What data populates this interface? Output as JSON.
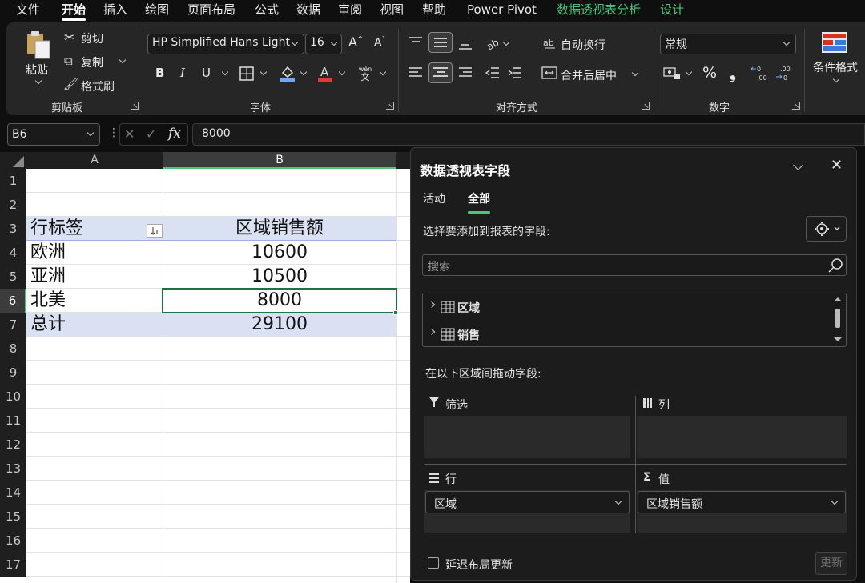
{
  "menu": {
    "tabs": [
      "文件",
      "开始",
      "插入",
      "绘图",
      "页面布局",
      "公式",
      "数据",
      "审阅",
      "视图",
      "帮助",
      "Power Pivot",
      "数据透视表分析",
      "设计"
    ]
  },
  "ribbon": {
    "clipboard": {
      "paste": "粘贴",
      "cut": "剪切",
      "copy": "复制",
      "format_painter": "格式刷",
      "label": "剪贴板"
    },
    "font": {
      "name": "HP Simplified Hans Light",
      "size": "16",
      "bold": "B",
      "italic": "I",
      "underline": "U",
      "label": "字体",
      "wen_top": "wén",
      "wen_bottom": "文"
    },
    "alignment": {
      "wrap": "自动换行",
      "merge": "合并后居中",
      "label": "对齐方式"
    },
    "number": {
      "format": "常规",
      "label": "数字",
      "percent": "%",
      "comma": "❟",
      "dec_inc": "←0 .00",
      "dec_dec": ".00 →0"
    },
    "styles": {
      "conditional": "条件格式"
    }
  },
  "formula_bar": {
    "name_box": "B6",
    "fx": "fx",
    "value": "8000"
  },
  "sheet": {
    "columns": [
      "A",
      "B"
    ],
    "rows": [
      "1",
      "2",
      "3",
      "4",
      "5",
      "6",
      "7",
      "8",
      "9",
      "10",
      "11",
      "12",
      "13",
      "14",
      "15",
      "16",
      "17"
    ],
    "pivot_table": {
      "header": [
        "行标签",
        "区域销售额"
      ],
      "data": [
        [
          "欧洲",
          "10600"
        ],
        [
          "亚洲",
          "10500"
        ],
        [
          "北美",
          "8000"
        ]
      ],
      "total": [
        "总计",
        "29100"
      ]
    }
  },
  "pivot_pane": {
    "title": "数据透视表字段",
    "tabs": [
      "活动",
      "全部"
    ],
    "choose_label": "选择要添加到报表的字段:",
    "search_placeholder": "搜索",
    "fields": [
      "区域",
      "销售"
    ],
    "drag_label": "在以下区域间拖动字段:",
    "areas": {
      "filters": "筛选",
      "columns": "列",
      "rows": "行",
      "values": "值"
    },
    "row_field": "区域",
    "value_field": "区域销售额",
    "defer_label": "延迟布局更新",
    "update_button": "更新"
  },
  "colors": {
    "accent_green": "#4fc27b",
    "pivot_header_fill": "#d9e1f2",
    "selection_border": "#1e7145"
  }
}
